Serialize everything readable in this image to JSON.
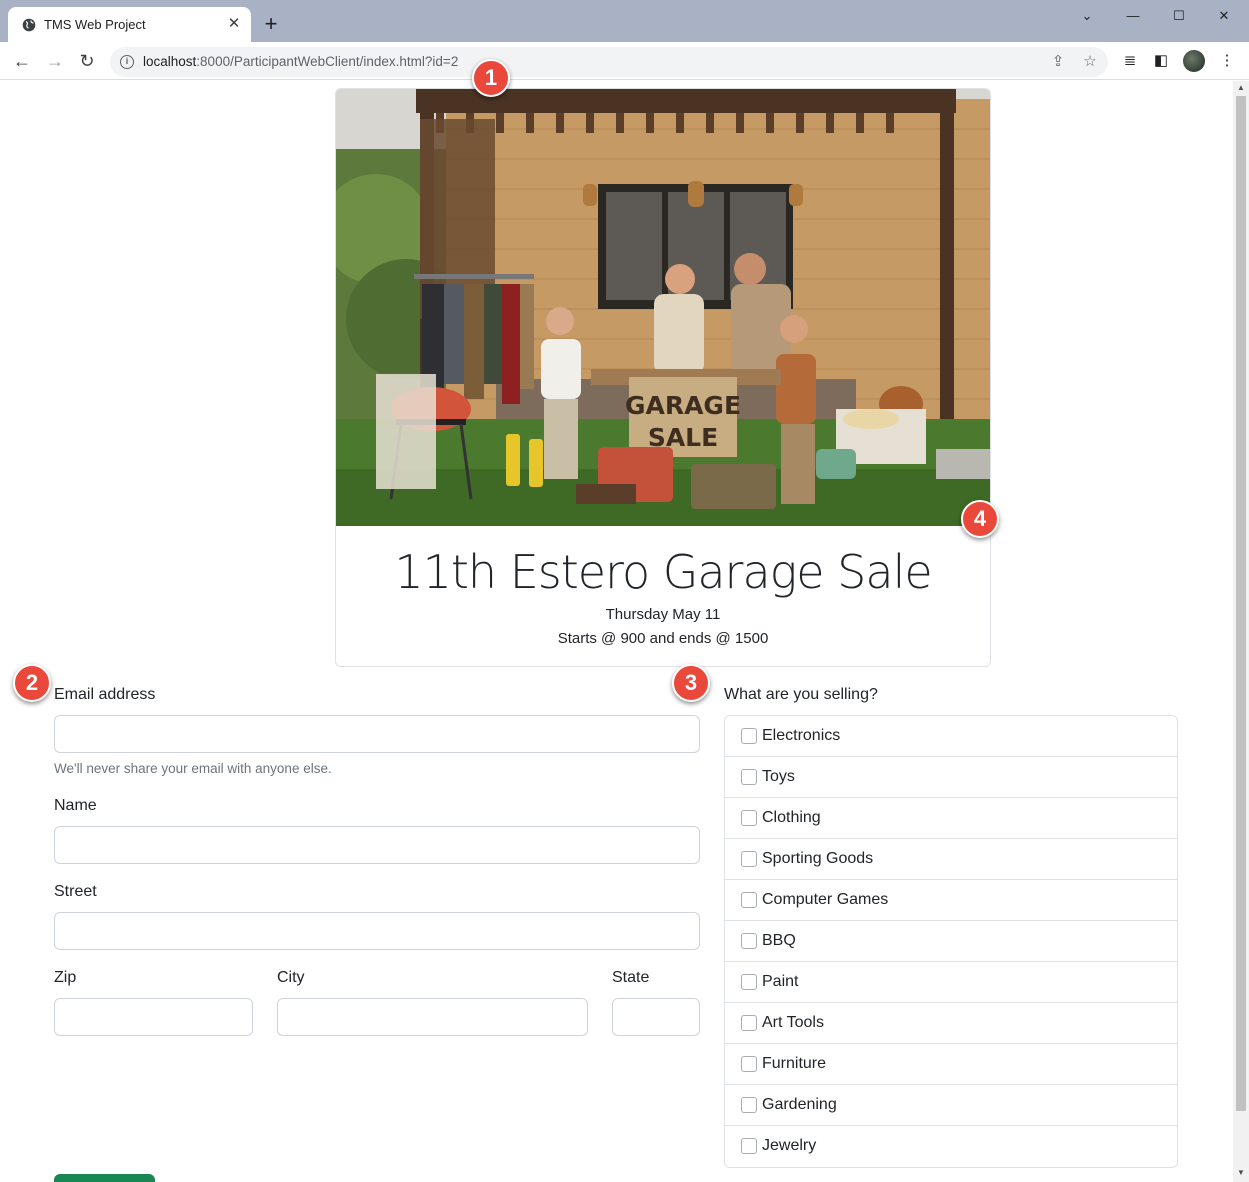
{
  "browser": {
    "tab_title": "TMS Web Project",
    "url_host": "localhost",
    "url_rest": ":8000/ParticipantWebClient/index.html?id=2"
  },
  "event": {
    "title": "11th Estero Garage Sale",
    "date": "Thursday May 11",
    "time": "Starts @ 900 and ends @ 1500",
    "sign_line1": "GARAGE",
    "sign_line2": "SALE"
  },
  "form": {
    "email_label": "Email address",
    "email_help": "We'll never share your email with anyone else.",
    "name_label": "Name",
    "street_label": "Street",
    "zip_label": "Zip",
    "city_label": "City",
    "state_label": "State"
  },
  "selling": {
    "question": "What are you selling?",
    "items": [
      {
        "label": "Electronics"
      },
      {
        "label": "Toys"
      },
      {
        "label": "Clothing"
      },
      {
        "label": "Sporting Goods"
      },
      {
        "label": "Computer Games"
      },
      {
        "label": "BBQ"
      },
      {
        "label": "Paint"
      },
      {
        "label": "Art Tools"
      },
      {
        "label": "Furniture"
      },
      {
        "label": "Gardening"
      },
      {
        "label": "Jewelry"
      }
    ]
  },
  "callouts": {
    "one": "1",
    "two": "2",
    "three": "3",
    "four": "4"
  },
  "colors": {
    "submit": "#198754",
    "callout": "#e9483b",
    "titlebar": "#a9b1c4"
  }
}
